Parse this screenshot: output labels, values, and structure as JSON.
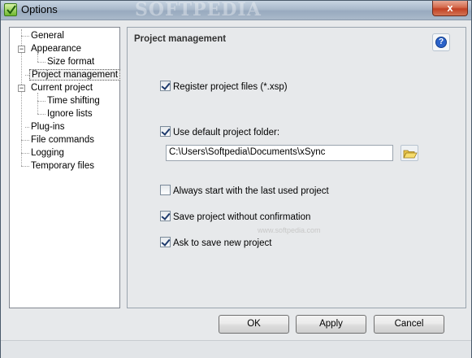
{
  "window": {
    "title": "Options",
    "watermark": "SOFTPEDIA",
    "close_label": "x"
  },
  "tree": {
    "items": [
      {
        "label": "General"
      },
      {
        "label": "Appearance"
      },
      {
        "label": "Size format"
      },
      {
        "label": "Project management",
        "selected": true
      },
      {
        "label": "Current project"
      },
      {
        "label": "Time shifting"
      },
      {
        "label": "Ignore lists"
      },
      {
        "label": "Plug-ins"
      },
      {
        "label": "File commands"
      },
      {
        "label": "Logging"
      },
      {
        "label": "Temporary files"
      }
    ]
  },
  "panel": {
    "title": "Project management",
    "help_label": "?",
    "register_files": {
      "label": "Register project files (*.xsp)",
      "checked": true
    },
    "use_default_folder": {
      "label": "Use default project folder:",
      "checked": true
    },
    "folder_path": "C:\\Users\\Softpedia\\Documents\\xSync",
    "always_start_last": {
      "label": "Always start with the last used project",
      "checked": false
    },
    "save_without_confirm": {
      "label": "Save project without confirmation",
      "checked": true
    },
    "ask_save_new": {
      "label": "Ask to save new project",
      "checked": true
    },
    "watermark": "www.softpedia.com"
  },
  "buttons": {
    "ok": "OK",
    "apply": "Apply",
    "cancel": "Cancel"
  },
  "icons": {
    "app": "check-icon",
    "help": "help-icon",
    "browse": "folder-open-icon"
  }
}
